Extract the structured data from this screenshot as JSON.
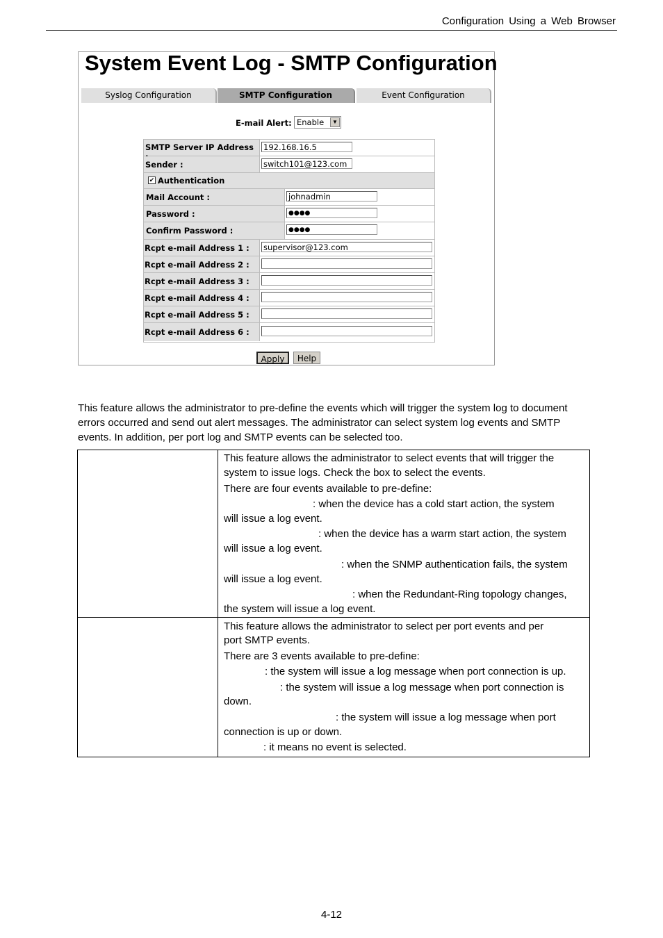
{
  "header": {
    "running_title": "Configuration  Using  a  Web  Browser"
  },
  "screenshot": {
    "title": "System Event Log - SMTP Configuration",
    "tabs": [
      {
        "label": "Syslog Configuration",
        "active": false
      },
      {
        "label": "SMTP Configuration",
        "active": true
      },
      {
        "label": "Event Configuration",
        "active": false
      }
    ],
    "email_alert": {
      "label": "E-mail Alert:",
      "value": "Enable"
    },
    "fields": {
      "smtp_server": {
        "label": "SMTP Server IP Address :",
        "value": "192.168.16.5"
      },
      "sender": {
        "label": "Sender :",
        "value": "switch101@123.com"
      },
      "authentication": {
        "label": "Authentication",
        "checked": true
      },
      "mail_account": {
        "label": "Mail Account :",
        "value": "johnadmin"
      },
      "password": {
        "label": "Password :",
        "value": "●●●●"
      },
      "confirm_password": {
        "label": "Confirm Password :",
        "value": "●●●●"
      }
    },
    "recipients": [
      {
        "label": "Rcpt e-mail Address 1 :",
        "value": "supervisor@123.com"
      },
      {
        "label": "Rcpt e-mail Address 2 :",
        "value": ""
      },
      {
        "label": "Rcpt e-mail Address 3 :",
        "value": ""
      },
      {
        "label": "Rcpt e-mail Address 4 :",
        "value": ""
      },
      {
        "label": "Rcpt e-mail Address 5 :",
        "value": ""
      },
      {
        "label": "Rcpt e-mail Address 6 :",
        "value": ""
      }
    ],
    "buttons": {
      "apply": "Apply",
      "help": "Help"
    }
  },
  "body": {
    "paragraph": [
      "This feature allows the administrator to pre-define the events which will trigger the system log to document",
      "errors occurred and send out alert messages. The administrator can select system log events and SMTP",
      "events. In addition, per port log and SMTP events can be selected too."
    ]
  },
  "table": {
    "row1": [
      "This feature allows the administrator to select events that will trigger the",
      "system to issue logs. Check the box to select the events.",
      "There are four events available to pre-define:",
      ": when the device has a cold start action, the system",
      "will issue a log event.",
      ": when the device has a warm start action, the system",
      "will issue a log event.",
      ": when the SNMP authentication fails, the system",
      "will issue a log event.",
      ": when the Redundant-Ring topology changes,",
      "the system will issue a log event."
    ],
    "row2": [
      "This feature allows the administrator to select per port events and per",
      "port SMTP events.",
      "There are 3 events available to pre-define:",
      ": the system will issue a log message when port connection is up.",
      ": the system will issue a log message when port connection is",
      "down.",
      ": the system will issue a log message when port",
      "connection is up or down.",
      ": it means no event is selected."
    ]
  },
  "footer": {
    "page_number": "4-12"
  }
}
